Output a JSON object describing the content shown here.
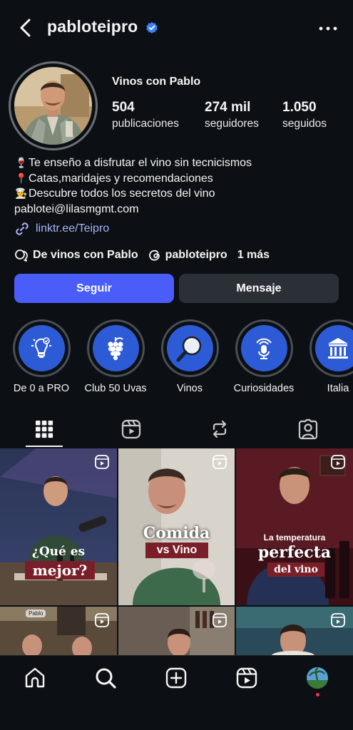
{
  "header": {
    "username": "pabloteipro",
    "verified": true,
    "back_icon": "chevron-left-icon",
    "more_icon": "more-horizontal-icon"
  },
  "profile": {
    "full_name": "Vinos con Pablo",
    "stats": [
      {
        "value": "504",
        "label": "publicaciones"
      },
      {
        "value": "274 mil",
        "label": "seguidores"
      },
      {
        "value": "1.050",
        "label": "seguidos"
      }
    ],
    "bio": [
      {
        "emoji": "🍷",
        "text": "Te enseño a disfrutar el vino sin tecnicismos"
      },
      {
        "emoji": "📍",
        "text": "Catas,maridajes y recomendaciones"
      },
      {
        "emoji": "👨‍🍳",
        "text": "Descubre todos los secretos del vino"
      },
      {
        "emoji": "",
        "text": "pablotei@lilasmgmt.com"
      }
    ],
    "link": "linktr.ee/Teipro",
    "threads": {
      "community": "De vinos con Pablo",
      "threads_user": "pabloteipro",
      "more": "1 más"
    },
    "follow_label": "Seguir",
    "message_label": "Mensaje"
  },
  "highlights": [
    {
      "label": "De 0 a PRO",
      "icon": "lightbulb-icon"
    },
    {
      "label": "Club 50 Uvas",
      "icon": "grapes-icon"
    },
    {
      "label": "Vinos",
      "icon": "magnifier-icon"
    },
    {
      "label": "Curiosidades",
      "icon": "microphone-icon"
    },
    {
      "label": "Italia",
      "icon": "temple-icon"
    }
  ],
  "tabs": [
    "grid-icon",
    "reels-icon",
    "reposts-icon",
    "tagged-icon"
  ],
  "posts": [
    {
      "line1": "¿Qué es",
      "line2": "mejor?"
    },
    {
      "line1": "Comida",
      "line2": "vs Vino"
    },
    {
      "line1": "La temperatura",
      "line2": "perfecta",
      "line3": "del vino"
    },
    {
      "badge": "Pablo"
    }
  ],
  "colors": {
    "background": "#0c1014",
    "accent": "#4a5df9",
    "secondary_button": "#2b3036",
    "link": "#a8b4f8",
    "highlight_fill": "#2d5bd6"
  }
}
